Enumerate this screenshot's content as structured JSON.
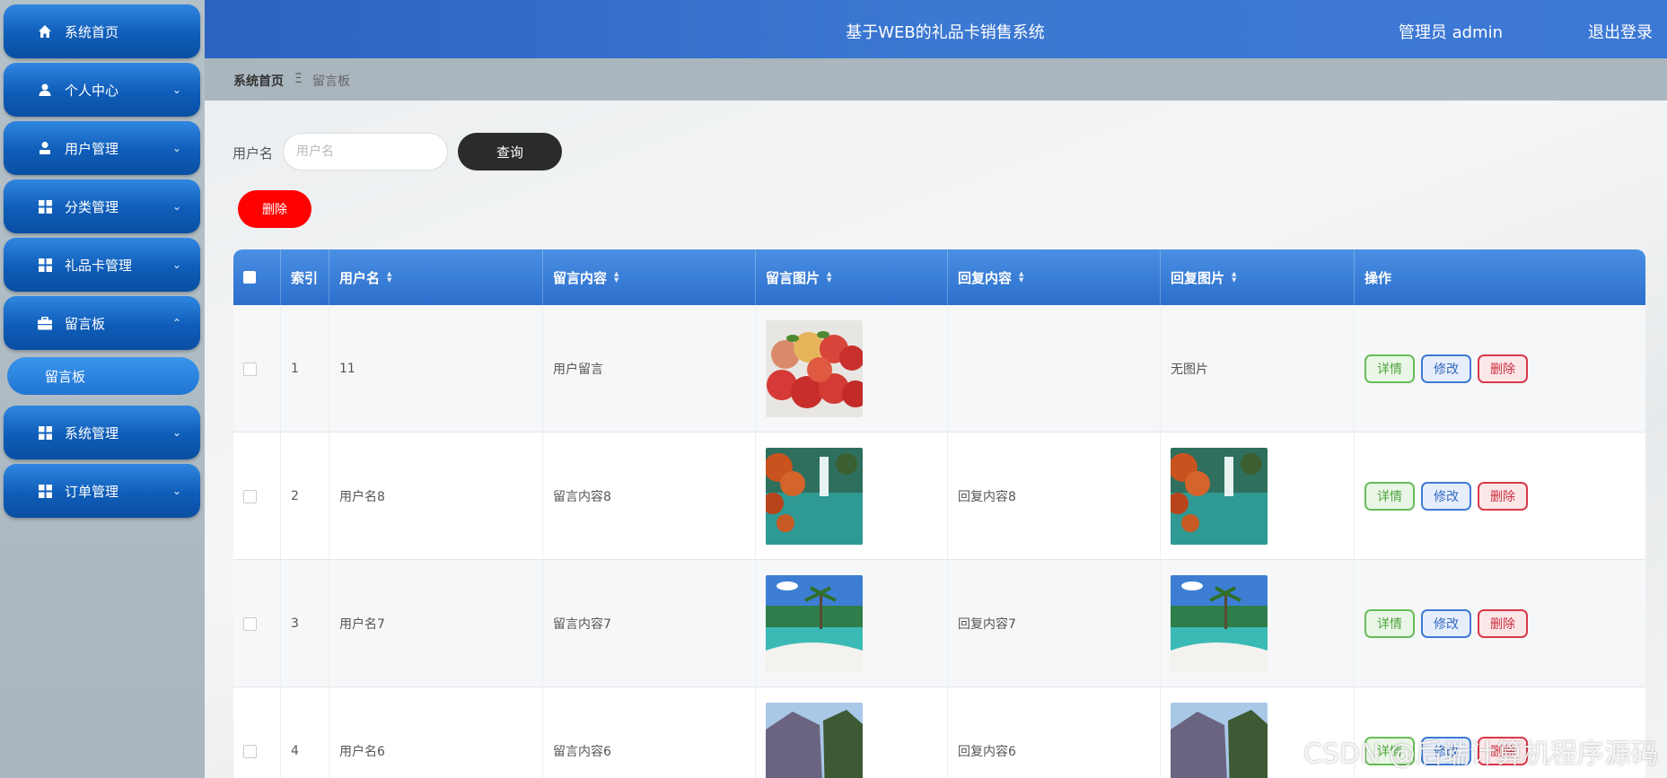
{
  "header": {
    "title": "基于WEB的礼品卡销售系统",
    "admin": "管理员 admin",
    "logout": "退出登录"
  },
  "sidebar": {
    "items": [
      {
        "label": "系统首页",
        "icon": "home-icon",
        "chevron": ""
      },
      {
        "label": "个人中心",
        "icon": "user-icon",
        "chevron": "⌄"
      },
      {
        "label": "用户管理",
        "icon": "user-admin-icon",
        "chevron": "⌄"
      },
      {
        "label": "分类管理",
        "icon": "grid-icon",
        "chevron": "⌄"
      },
      {
        "label": "礼品卡管理",
        "icon": "grid-icon",
        "chevron": "⌄"
      },
      {
        "label": "留言板",
        "icon": "briefcase-icon",
        "chevron": "⌃"
      },
      {
        "label": "系统管理",
        "icon": "grid-icon",
        "chevron": "⌄"
      },
      {
        "label": "订单管理",
        "icon": "grid-icon",
        "chevron": "⌄"
      }
    ],
    "submenu": {
      "label": "留言板"
    }
  },
  "breadcrumb": {
    "home": "系统首页",
    "sep": "Ξ",
    "current": "留言板"
  },
  "search": {
    "label": "用户名",
    "placeholder": "用户名",
    "query_button": "查询"
  },
  "actions": {
    "delete_button": "删除"
  },
  "table": {
    "columns": [
      "索引",
      "用户名",
      "留言内容",
      "留言图片",
      "回复内容",
      "回复图片",
      "操作"
    ],
    "rows": [
      {
        "index": "1",
        "username": "11",
        "content": "用户留言",
        "image": "apples",
        "reply": "",
        "reply_image": "none",
        "reply_image_text": "无图片"
      },
      {
        "index": "2",
        "username": "用户名8",
        "content": "留言内容8",
        "image": "waterfall",
        "reply": "回复内容8",
        "reply_image": "waterfall",
        "reply_image_text": ""
      },
      {
        "index": "3",
        "username": "用户名7",
        "content": "留言内容7",
        "image": "beach",
        "reply": "回复内容7",
        "reply_image": "beach",
        "reply_image_text": ""
      },
      {
        "index": "4",
        "username": "用户名6",
        "content": "留言内容6",
        "image": "cliff",
        "reply": "回复内容6",
        "reply_image": "cliff",
        "reply_image_text": ""
      }
    ],
    "ops": {
      "detail": "详情",
      "edit": "修改",
      "delete": "删除"
    }
  },
  "watermark": "CSDN @后端计算机程序源码"
}
